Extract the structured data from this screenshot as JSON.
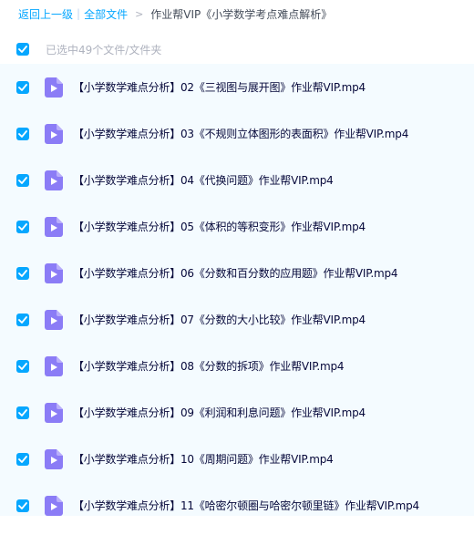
{
  "breadcrumb": {
    "back_label": "返回上一级",
    "separator": "|",
    "all_files_label": "全部文件",
    "arrow": ">",
    "current_folder": "作业帮VIP《小学数学考点难点解析》"
  },
  "selection": {
    "summary": "已选中49个文件/文件夹",
    "all_checked": true
  },
  "colors": {
    "accent": "#06a7ff",
    "video_icon": "#8b7cf6",
    "row_bg": "#f4fbff"
  },
  "files": [
    {
      "name": "【小学数学难点分析】02《三视图与展开图》作业帮VIP.mp4",
      "icon": "video-file-icon",
      "checked": true
    },
    {
      "name": "【小学数学难点分析】03《不规则立体图形的表面积》作业帮VIP.mp4",
      "icon": "video-file-icon",
      "checked": true
    },
    {
      "name": "【小学数学难点分析】04《代换问题》作业帮VIP.mp4",
      "icon": "video-file-icon",
      "checked": true
    },
    {
      "name": "【小学数学难点分析】05《体积的等积变形》作业帮VIP.mp4",
      "icon": "video-file-icon",
      "checked": true
    },
    {
      "name": "【小学数学难点分析】06《分数和百分数的应用题》作业帮VIP.mp4",
      "icon": "video-file-icon",
      "checked": true
    },
    {
      "name": "【小学数学难点分析】07《分数的大小比较》作业帮VIP.mp4",
      "icon": "video-file-icon",
      "checked": true
    },
    {
      "name": "【小学数学难点分析】08《分数的拆项》作业帮VIP.mp4",
      "icon": "video-file-icon",
      "checked": true
    },
    {
      "name": "【小学数学难点分析】09《利润和利息问题》作业帮VIP.mp4",
      "icon": "video-file-icon",
      "checked": true
    },
    {
      "name": "【小学数学难点分析】10《周期问题》作业帮VIP.mp4",
      "icon": "video-file-icon",
      "checked": true
    },
    {
      "name": "【小学数学难点分析】11《哈密尔顿圈与哈密尔顿里链》作业帮VIP.mp4",
      "icon": "video-file-icon",
      "checked": true
    }
  ]
}
